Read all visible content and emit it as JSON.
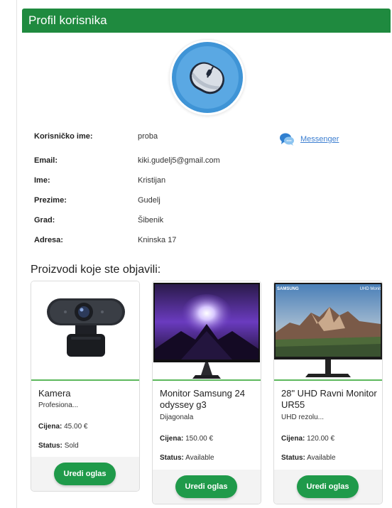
{
  "header": {
    "title": "Profil korisnika"
  },
  "profile": {
    "avatar_icon": "computer-mouse-icon",
    "fields": [
      {
        "label": "Korisničko ime:",
        "value": "proba"
      },
      {
        "label": "Email:",
        "value": "kiki.gudelj5@gmail.com"
      },
      {
        "label": "Ime:",
        "value": "Kristijan"
      },
      {
        "label": "Prezime:",
        "value": "Gudelj"
      },
      {
        "label": "Grad:",
        "value": "Šibenik"
      },
      {
        "label": "Adresa:",
        "value": "Kninska 17"
      }
    ],
    "messenger": {
      "label": "Messenger",
      "icon": "messenger-chat-icon"
    }
  },
  "products": {
    "title": "Proizvodi koje ste objavili:",
    "price_label": "Cijena:",
    "status_label": "Status:",
    "edit_label": "Uredi oglas",
    "items": [
      {
        "name": "Kamera",
        "desc": "Profesiona...",
        "price": "45.00 €",
        "status": "Sold",
        "image": "webcam"
      },
      {
        "name": "Monitor Samsung 24 odyssey g3",
        "desc": "Dijagonala",
        "price": "150.00 €",
        "status": "Available",
        "image": "gaming-monitor",
        "brand_text": ""
      },
      {
        "name": "28\" UHD Ravni Monitor UR55",
        "desc": "UHD rezolu...",
        "price": "120.00 €",
        "status": "Available",
        "image": "uhd-monitor",
        "brand_text": "SAMSUNG",
        "badge_text": "UHD Monit"
      }
    ]
  },
  "colors": {
    "header": "#1f8a3f",
    "button": "#1f9a4a",
    "link": "#3d7fd1",
    "card_accent": "#5cb85c"
  }
}
